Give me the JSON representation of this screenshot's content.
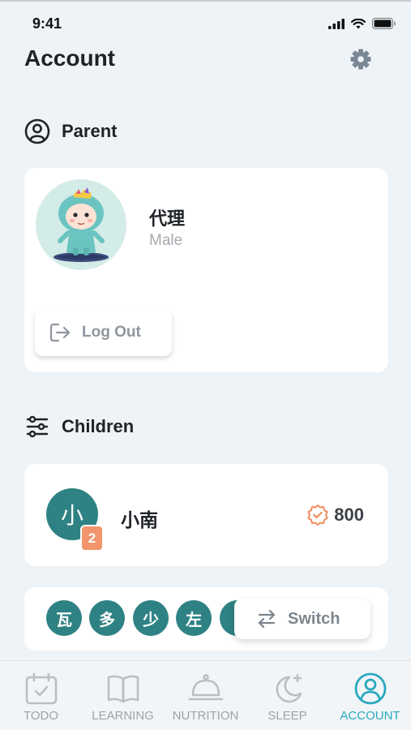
{
  "status_bar": {
    "time": "9:41"
  },
  "header": {
    "title": "Account"
  },
  "parent_section": {
    "title": "Parent",
    "name": "代理",
    "gender": "Male",
    "logout_label": "Log Out"
  },
  "children_section": {
    "title": "Children",
    "current_child": {
      "initial": "小",
      "badge": "2",
      "name": "小南",
      "points": "800"
    },
    "chips": [
      "瓦",
      "多",
      "少",
      "左"
    ],
    "switch_label": "Switch"
  },
  "tabbar": {
    "items": [
      {
        "label": "TODO",
        "icon": "todo-icon"
      },
      {
        "label": "LEARNING",
        "icon": "book-icon"
      },
      {
        "label": "NUTRITION",
        "icon": "cloche-icon"
      },
      {
        "label": "SLEEP",
        "icon": "moon-icon"
      },
      {
        "label": "ACCOUNT",
        "icon": "account-icon"
      }
    ],
    "active": "ACCOUNT"
  },
  "colors": {
    "accent": "#2f8284",
    "active_tab": "#2aa9bf",
    "badge": "#f2956a",
    "background": "#eef3f7"
  }
}
